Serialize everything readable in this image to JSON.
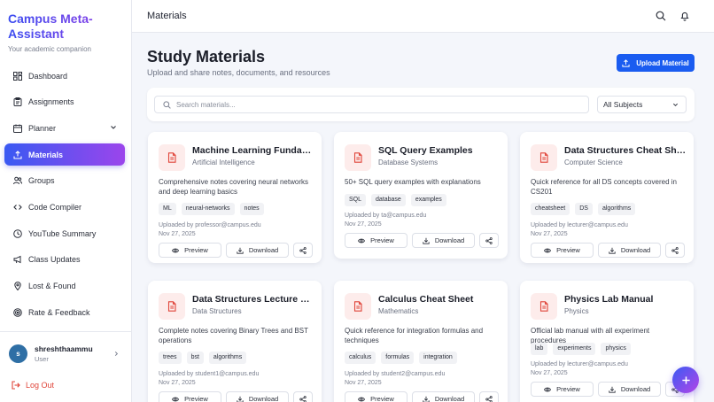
{
  "brand": {
    "title": "Campus Meta-Assistant",
    "subtitle": "Your academic companion"
  },
  "nav": [
    {
      "label": "Dashboard",
      "icon": "dashboard-icon"
    },
    {
      "label": "Assignments",
      "icon": "clipboard-icon"
    },
    {
      "label": "Planner",
      "icon": "calendar-icon",
      "expandable": true
    },
    {
      "label": "Materials",
      "icon": "upload-icon",
      "active": true
    },
    {
      "label": "Groups",
      "icon": "users-icon"
    },
    {
      "label": "Code Compiler",
      "icon": "code-icon"
    },
    {
      "label": "YouTube Summary",
      "icon": "clock-icon"
    },
    {
      "label": "Class Updates",
      "icon": "megaphone-icon"
    },
    {
      "label": "Lost & Found",
      "icon": "map-pin-icon"
    },
    {
      "label": "Rate & Feedback",
      "icon": "target-icon"
    }
  ],
  "user": {
    "initial": "s",
    "name": "shreshthaammu",
    "role": "User"
  },
  "logout_label": "Log Out",
  "header": {
    "title": "Materials"
  },
  "page": {
    "title": "Study Materials",
    "subtitle": "Upload and share notes, documents, and resources",
    "upload_label": "Upload Material"
  },
  "filters": {
    "search_placeholder": "Search materials...",
    "subject_value": "All Subjects"
  },
  "actions": {
    "preview": "Preview",
    "download": "Download"
  },
  "cards": [
    {
      "title": "Machine Learning Fundamen...",
      "subject": "Artificial Intelligence",
      "description": "Comprehensive notes covering neural networks and deep learning basics",
      "tags": [
        "ML",
        "neural-networks",
        "notes"
      ],
      "uploader": "Uploaded by professor@campus.edu",
      "date": "Nov 27, 2025"
    },
    {
      "title": "SQL Query Examples",
      "subject": "Database Systems",
      "description": "50+ SQL query examples with explanations",
      "tags": [
        "SQL",
        "database",
        "examples"
      ],
      "uploader": "Uploaded by ta@campus.edu",
      "date": "Nov 27, 2025"
    },
    {
      "title": "Data Structures Cheat Sheet",
      "subject": "Computer Science",
      "description": "Quick reference for all DS concepts covered in CS201",
      "tags": [
        "cheatsheet",
        "DS",
        "algorithms"
      ],
      "uploader": "Uploaded by lecturer@campus.edu",
      "date": "Nov 27, 2025"
    },
    {
      "title": "Data Structures Lecture Note...",
      "subject": "Data Structures",
      "description": "Complete notes covering Binary Trees and BST operations",
      "tags": [
        "trees",
        "bst",
        "algorithms"
      ],
      "uploader": "Uploaded by student1@campus.edu",
      "date": "Nov 27, 2025"
    },
    {
      "title": "Calculus Cheat Sheet",
      "subject": "Mathematics",
      "description": "Quick reference for integration formulas and techniques",
      "tags": [
        "calculus",
        "formulas",
        "integration"
      ],
      "uploader": "Uploaded by student2@campus.edu",
      "date": "Nov 27, 2025"
    },
    {
      "title": "Physics Lab Manual",
      "subject": "Physics",
      "description": "Official lab manual with all experiment procedures",
      "tags": [
        "lab",
        "experiments",
        "physics"
      ],
      "uploader": "Uploaded by lecturer@campus.edu",
      "date": "Nov 27, 2025"
    }
  ]
}
